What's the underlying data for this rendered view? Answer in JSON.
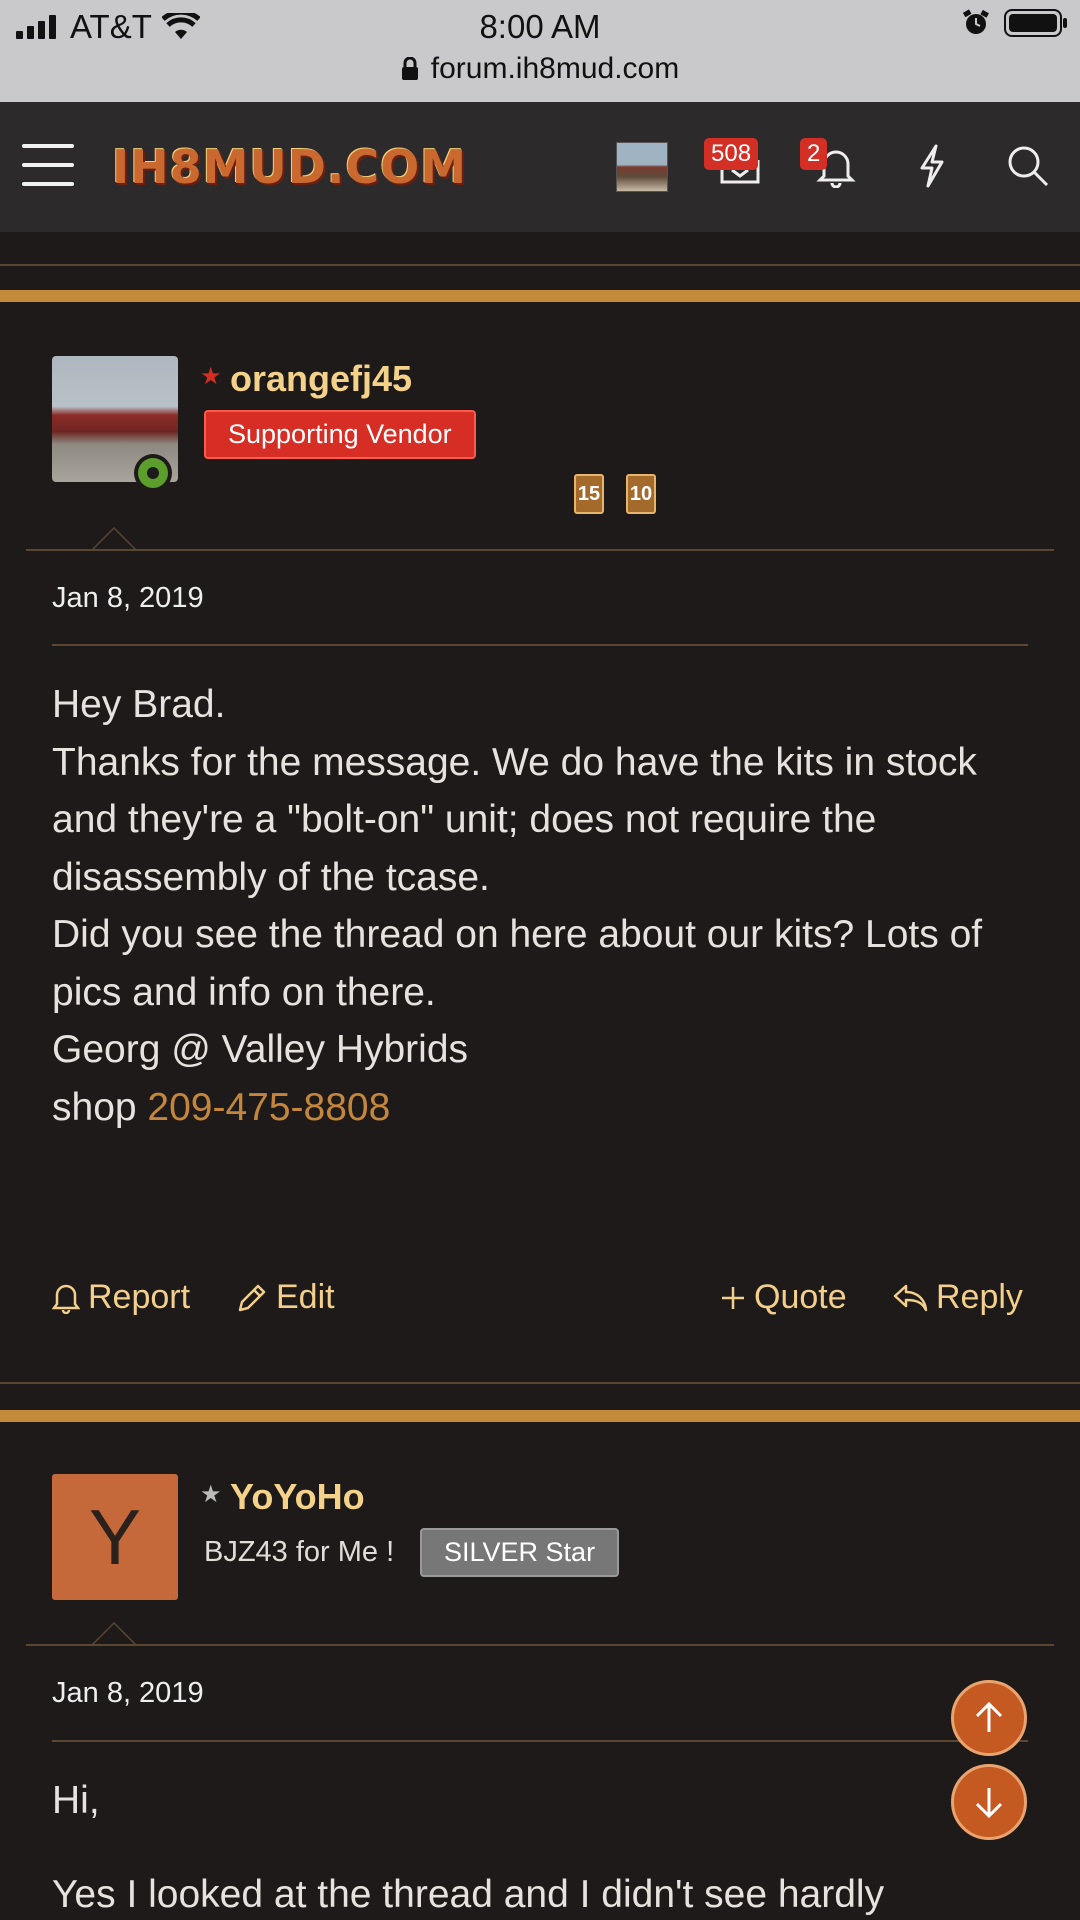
{
  "status_bar": {
    "carrier": "AT&T",
    "time": "8:00 AM",
    "url": "forum.ih8mud.com"
  },
  "header": {
    "logo_text": "IH8MUD.COM",
    "inbox_badge": "508",
    "alerts_badge": "2",
    "icons": [
      "menu-icon",
      "inbox-icon",
      "bell-icon",
      "lightning-icon",
      "search-icon"
    ]
  },
  "posts": [
    {
      "username": "orangefj45",
      "user_badge": "Supporting Vendor",
      "trophies": [
        "15",
        "10"
      ],
      "date": "Jan 8, 2019",
      "body": [
        "Hey Brad.",
        "Thanks for the message. We do have the kits in stock and they're a \"bolt-on\" unit; does not require the disassembly of the tcase.",
        "Did you see the thread on here about our kits? Lots of pics and info on there.",
        "Georg @ Valley Hybrids"
      ],
      "shop_label": "shop ",
      "shop_phone": "209-475-8808",
      "actions": {
        "report": "Report",
        "edit": "Edit",
        "quote": "Quote",
        "reply": "Reply"
      }
    },
    {
      "avatar_letter": "Y",
      "username": "YoYoHo",
      "user_title": "BJZ43 for Me !",
      "user_badge": "SILVER Star",
      "date": "Jan 8, 2019",
      "body": [
        "Hi,",
        "Yes I looked at the thread and I didn't see hardly"
      ]
    }
  ],
  "colors": {
    "accent": "#c48a3c",
    "username": "#f5d28a",
    "vendor_badge": "#d62e25",
    "background": "#1e1a19"
  }
}
